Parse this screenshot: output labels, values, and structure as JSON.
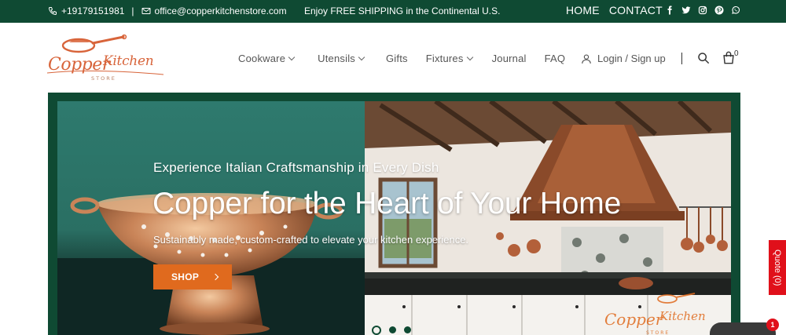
{
  "topbar": {
    "phone": "+19179151981",
    "separator": "|",
    "email": "office@copperkitchenstore.com",
    "promo": "Enjoy FREE SHIPPING in the Continental U.S.",
    "links": {
      "home": "HOME",
      "contact": "CONTACT"
    },
    "social_icons": [
      "facebook-icon",
      "twitter-icon",
      "instagram-icon",
      "pinterest-icon",
      "whatsapp-icon"
    ]
  },
  "brand": {
    "name": "Copper Kitchen",
    "tagline": "STORE"
  },
  "nav": {
    "items": [
      {
        "label": "Cookware",
        "has_dropdown": true
      },
      {
        "label": "Utensils",
        "has_dropdown": true
      },
      {
        "label": "Gifts",
        "has_dropdown": false
      },
      {
        "label": "Fixtures",
        "has_dropdown": true
      },
      {
        "label": "Journal",
        "has_dropdown": false
      },
      {
        "label": "FAQ",
        "has_dropdown": false
      }
    ],
    "login_label": "Login / Sign up",
    "cart_count": "0"
  },
  "hero": {
    "eyebrow": "Experience Italian Craftsmanship in Every Dish",
    "title": "Copper for the Heart of Your Home",
    "subtitle": "Sustainably made, custom-crafted to elevate your kitchen experience.",
    "cta_label": "SHOP",
    "slides_total": 3,
    "active_slide": 1
  },
  "quote_tab": {
    "label": "Quote (0)"
  },
  "chat": {
    "badge": "1"
  },
  "colors": {
    "brand_green": "#0f4a33",
    "accent_orange": "#e06a1e",
    "quote_red": "#e0101a",
    "logo_copper": "#d8643a"
  }
}
